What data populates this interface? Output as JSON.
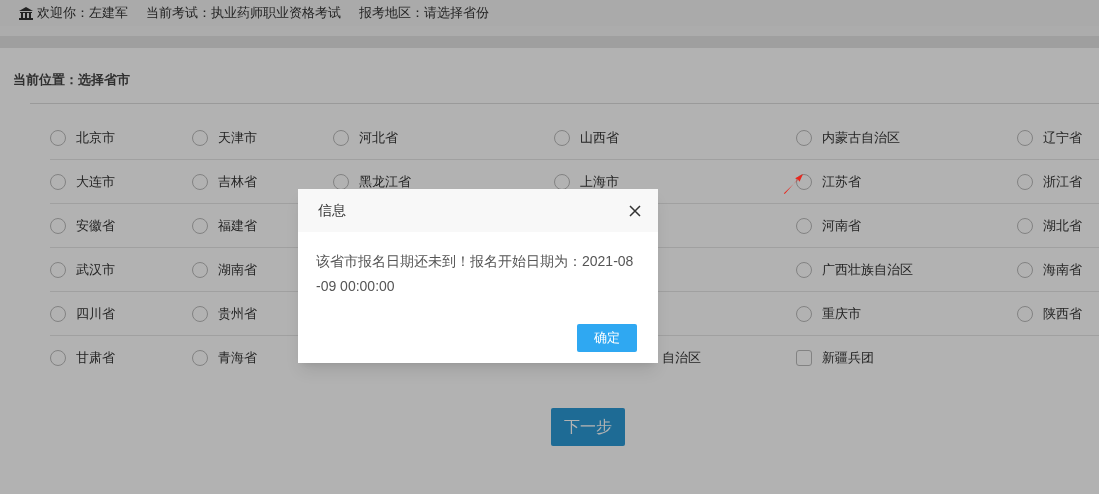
{
  "header": {
    "welcome": "欢迎你：左建军",
    "exam": "当前考试：执业药师职业资格考试",
    "region": "报考地区：请选择省份"
  },
  "breadcrumb": "当前位置：选择省市",
  "regions": [
    [
      {
        "kind": "radio",
        "label": "北京市",
        "selected": false
      },
      {
        "kind": "radio",
        "label": "天津市",
        "selected": false
      },
      {
        "kind": "radio",
        "label": "河北省",
        "selected": false
      },
      {
        "kind": "radio",
        "label": "山西省",
        "selected": false
      },
      {
        "kind": "radio",
        "label": "内蒙古自治区",
        "selected": false
      },
      {
        "kind": "radio",
        "label": "辽宁省",
        "selected": false
      }
    ],
    [
      {
        "kind": "radio",
        "label": "大连市",
        "selected": false
      },
      {
        "kind": "radio",
        "label": "吉林省",
        "selected": false
      },
      {
        "kind": "radio",
        "label": "黑龙江省",
        "selected": false
      },
      {
        "kind": "radio",
        "label": "上海市",
        "selected": false
      },
      {
        "kind": "radio",
        "label": "江苏省",
        "selected": false
      },
      {
        "kind": "radio",
        "label": "浙江省",
        "selected": false
      }
    ],
    [
      {
        "kind": "radio",
        "label": "安徽省",
        "selected": false
      },
      {
        "kind": "radio",
        "label": "福建省",
        "selected": false
      },
      {
        "kind": "hidden"
      },
      {
        "kind": "hidden"
      },
      {
        "kind": "radio",
        "label": "河南省",
        "selected": false
      },
      {
        "kind": "radio",
        "label": "湖北省",
        "selected": false
      }
    ],
    [
      {
        "kind": "radio",
        "label": "武汉市",
        "selected": false
      },
      {
        "kind": "radio",
        "label": "湖南省",
        "selected": false
      },
      {
        "kind": "hidden"
      },
      {
        "kind": "hidden"
      },
      {
        "kind": "radio",
        "label": "广西壮族自治区",
        "selected": false
      },
      {
        "kind": "radio",
        "label": "海南省",
        "selected": false
      }
    ],
    [
      {
        "kind": "radio",
        "label": "四川省",
        "selected": false
      },
      {
        "kind": "radio",
        "label": "贵州省",
        "selected": false
      },
      {
        "kind": "hidden"
      },
      {
        "kind": "hidden"
      },
      {
        "kind": "radio",
        "label": "重庆市",
        "selected": false
      },
      {
        "kind": "radio",
        "label": "陕西省",
        "selected": false
      }
    ],
    [
      {
        "kind": "radio",
        "label": "甘肃省",
        "selected": false
      },
      {
        "kind": "radio",
        "label": "青海省",
        "selected": false
      },
      {
        "kind": "hidden"
      },
      {
        "kind": "partial",
        "label": "自治区"
      },
      {
        "kind": "square",
        "label": "新疆兵团",
        "selected": false
      },
      {
        "kind": "hidden"
      }
    ]
  ],
  "next_button": "下一步",
  "dialog": {
    "title": "信息",
    "message": "该省市报名日期还未到！报名开始日期为：2021-08-09 00:00:00",
    "ok_button": "确定"
  }
}
